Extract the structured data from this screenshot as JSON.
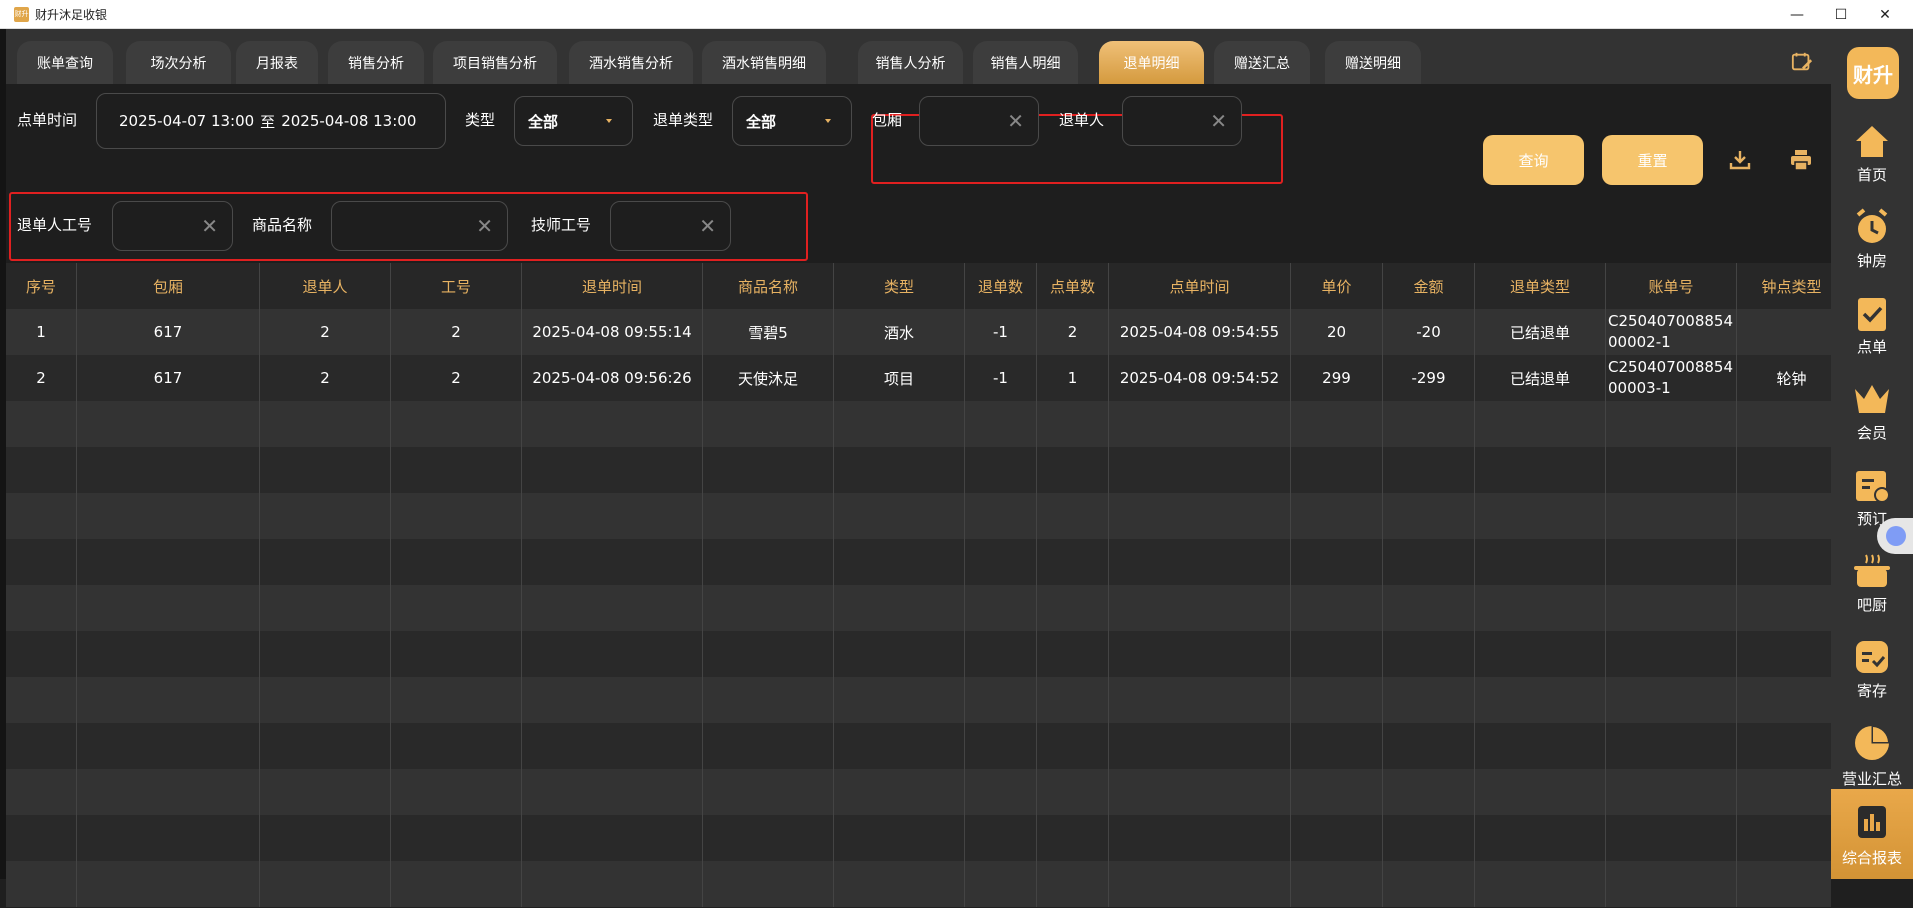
{
  "window": {
    "title": "财升沐足收银",
    "controls": [
      "—",
      "☐",
      "✕"
    ]
  },
  "tabs": [
    {
      "label": "账单查询"
    },
    {
      "label": "场次分析"
    },
    {
      "label": "月报表"
    },
    {
      "label": "销售分析"
    },
    {
      "label": "项目销售分析"
    },
    {
      "label": "酒水销售分析"
    },
    {
      "label": "酒水销售明细"
    },
    {
      "label": "销售人分析"
    },
    {
      "label": "销售人明细"
    },
    {
      "label": "退单明细",
      "active": true
    },
    {
      "label": "赠送汇总"
    },
    {
      "label": "赠送明细"
    }
  ],
  "filters": {
    "order_time_label": "点单时间",
    "date_start": "2025-04-07 13:00",
    "date_sep": "至",
    "date_end": "2025-04-08 13:00",
    "type_label": "类型",
    "type_value": "全部",
    "refund_type_label": "退单类型",
    "refund_type_value": "全部",
    "room_label": "包厢",
    "refunder_label": "退单人",
    "refunder_id_label": "退单人工号",
    "product_label": "商品名称",
    "tech_id_label": "技师工号",
    "clear_glyph": "✕",
    "query_button": "查询",
    "reset_button": "重置"
  },
  "table": {
    "columns": [
      "序号",
      "包厢",
      "退单人",
      "工号",
      "退单时间",
      "商品名称",
      "类型",
      "退单数",
      "点单数",
      "点单时间",
      "单价",
      "金额",
      "退单类型",
      "账单号",
      "钟点类型"
    ],
    "rows": [
      [
        "1",
        "617",
        "2",
        "2",
        "2025-04-08 09:55:14",
        "雪碧5",
        "酒水",
        "-1",
        "2",
        "2025-04-08 09:54:55",
        "20",
        "-20",
        "已结退单",
        "C250407008854\n00002-1",
        ""
      ],
      [
        "2",
        "617",
        "2",
        "2",
        "2025-04-08 09:56:26",
        "天使沐足",
        "项目",
        "-1",
        "1",
        "2025-04-08 09:54:52",
        "299",
        "-299",
        "已结退单",
        "C250407008854\n00003-1",
        "轮钟"
      ]
    ]
  },
  "sidebar": {
    "logo": "财升",
    "items": [
      {
        "label": "首页",
        "icon": "home-icon"
      },
      {
        "label": "钟房",
        "icon": "alarm-clock-icon"
      },
      {
        "label": "点单",
        "icon": "clipboard-check-icon"
      },
      {
        "label": "会员",
        "icon": "crown-icon"
      },
      {
        "label": "预订",
        "icon": "calendar-clock-icon"
      },
      {
        "label": "吧厨",
        "icon": "cooking-pot-icon"
      },
      {
        "label": "寄存",
        "icon": "storage-box-icon"
      },
      {
        "label": "营业汇总",
        "icon": "pie-chart-icon"
      },
      {
        "label": "综合报表",
        "icon": "report-icon",
        "active": true
      }
    ]
  },
  "colors": {
    "accent": "#e7b262",
    "button": "#f6c56d",
    "highlight": "#e02020",
    "background": "#141414"
  }
}
